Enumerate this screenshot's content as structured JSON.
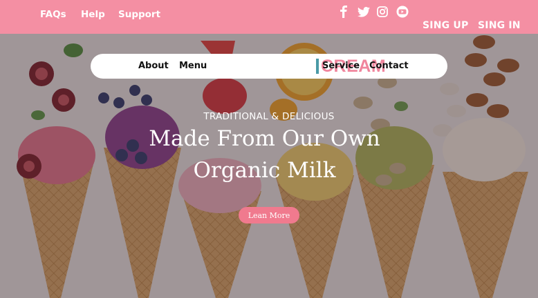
{
  "topbar": {
    "links": [
      "FAQs",
      "Help",
      "Support"
    ],
    "auth": {
      "signup": "SING UP",
      "signin": "SING IN"
    },
    "social_icons": [
      "facebook-icon",
      "twitter-icon",
      "instagram-icon",
      "youtube-icon"
    ]
  },
  "nav": {
    "about": "About",
    "menu": "Menu",
    "logo": "CREAM",
    "service": "Service",
    "contact": "Contact"
  },
  "hero": {
    "eyebrow": "TRADITIONAL & DELICIOUS",
    "headline_line1": "Made From Our Own",
    "headline_line2": "Organic Milk",
    "cta": "Lean More"
  },
  "colors": {
    "brand_pink": "#f48fa3",
    "logo_pink": "#f0859d",
    "logo_teal": "#4a9aa6",
    "button_pink": "#f07a8e"
  }
}
